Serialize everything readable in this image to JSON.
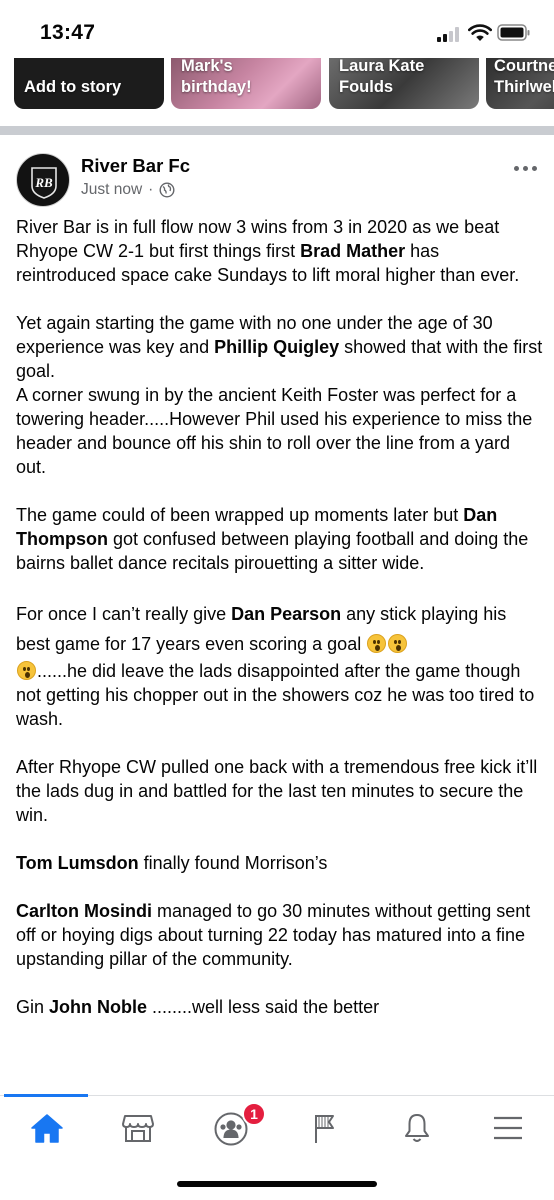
{
  "status_bar": {
    "time": "13:47"
  },
  "stories": [
    {
      "label": "Add to story"
    },
    {
      "label": "Mark's\nbirthday!"
    },
    {
      "label": "Laura Kate\nFoulds"
    },
    {
      "label": "Courtney\nThirlwell"
    }
  ],
  "post": {
    "author": "River Bar Fc",
    "avatar_text": "RB",
    "timestamp": "Just now",
    "separator": "·",
    "paragraphs": {
      "p1_a": "River Bar is in full flow now 3 wins from 3 in 2020 as we beat Rhyope CW 2-1 but first things first ",
      "p1_b": "Brad Mather",
      "p1_c": " has reintroduced space cake Sundays to lift moral higher than ever.",
      "p2_a": "Yet again starting the game with no one under the age of 30 experience was key and ",
      "p2_b": "Phillip Quigley",
      "p2_c": " showed that with the first goal.",
      "p3": "A corner swung in by the ancient Keith Foster was perfect for a towering header.....However Phil used his experience to miss the header and bounce off his shin to roll over the line from a yard out.",
      "p4_a": "The game could of been wrapped up moments later but ",
      "p4_b": "Dan Thompson",
      "p4_c": " got confused between playing football and doing the bairns ballet dance recitals pirouetting a sitter wide.",
      "p5_a": "For once I can’t really give ",
      "p5_b": "Dan Pearson",
      "p5_c": " any stick playing his best game for 17 years even scoring a goal ",
      "p5_d": "......he did leave the lads disappointed after the game though not getting his chopper out in the showers coz he was too tired to wash.",
      "p6": "After Rhyope CW pulled one back with a tremendous free kick it’ll the lads dug in and battled for the last ten minutes to secure the win.",
      "p7_a": "Tom Lumsdon",
      "p7_b": " finally found Morrison’s",
      "p8_a": "Carlton Mosindi",
      "p8_b": " managed to go 30 minutes without  getting sent off or hoying digs about turning 22 today has matured into a fine upstanding pillar of the community.",
      "p9_a": "Gin ",
      "p9_b": "John Noble",
      "p9_c": " ........well less said the better"
    }
  },
  "bottom_nav": {
    "groups_badge": "1",
    "items": [
      "home-icon",
      "marketplace-icon",
      "groups-icon",
      "pages-flag-icon",
      "notifications-bell-icon",
      "menu-icon"
    ]
  },
  "colors": {
    "accent": "#1877f2",
    "badge": "#e41e3f",
    "meta": "#65676b",
    "divider": "#c9ccd1"
  }
}
